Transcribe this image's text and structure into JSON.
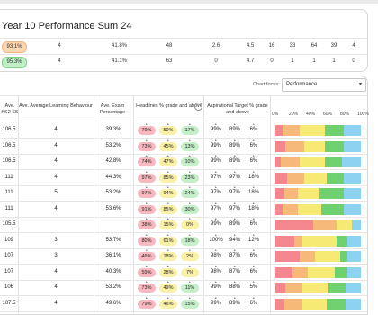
{
  "header": {
    "title": "Year  10  Performance  Sum  24"
  },
  "summary_rows": [
    {
      "badge": "93.1%",
      "badge_color": "orange",
      "values": [
        "4",
        "41.8%",
        "48",
        "2.6",
        "4.5",
        "16",
        "33",
        "64",
        "39",
        "4"
      ]
    },
    {
      "badge": "95.3%",
      "badge_color": "green",
      "values": [
        "4",
        "41.1%",
        "63",
        "0",
        "4.7",
        "0",
        "1",
        "1",
        "1",
        "0"
      ]
    }
  ],
  "chart_focus": {
    "label": "Chart focus:",
    "value": "Performance"
  },
  "columns": {
    "ks2": "Ave. KS2 SS",
    "alb": "Ave. Average Learning Behaviour",
    "exam": "Ave. Exam Percentage",
    "headlines": "Headlines % grade and above",
    "asp": "Aspirational Target % grade and above"
  },
  "pct_axis": [
    "0%",
    "20%",
    "40%",
    "60%",
    "80%",
    "100%"
  ],
  "colors": {
    "red": "#f4868e",
    "orange": "#f6b97a",
    "yellow": "#f7ea74",
    "green": "#6fd06f",
    "blue": "#8ed2f2"
  },
  "rows": [
    {
      "ks2": "106.5",
      "alb": "4",
      "exam": "39.3%",
      "h": [
        "79%",
        "50%",
        "17%"
      ],
      "a": [
        "99%",
        "89%",
        "6%"
      ],
      "dist": [
        8,
        20,
        30,
        22,
        20
      ]
    },
    {
      "ks2": "106.5",
      "alb": "4",
      "exam": "53.2%",
      "h": [
        "73%",
        "45%",
        "13%"
      ],
      "a": [
        "99%",
        "89%",
        "6%"
      ],
      "dist": [
        12,
        22,
        24,
        22,
        20
      ]
    },
    {
      "ks2": "106.5",
      "alb": "4",
      "exam": "42.8%",
      "h": [
        "74%",
        "47%",
        "10%"
      ],
      "a": [
        "99%",
        "89%",
        "6%"
      ],
      "dist": [
        6,
        22,
        30,
        20,
        22
      ]
    },
    {
      "ks2": "111",
      "alb": "4",
      "exam": "44.3%",
      "h": [
        "97%",
        "85%",
        "23%"
      ],
      "a": [
        "97%",
        "97%",
        "18%"
      ],
      "dist": [
        14,
        20,
        26,
        20,
        20
      ]
    },
    {
      "ks2": "111",
      "alb": "5",
      "exam": "53.2%",
      "h": [
        "97%",
        "94%",
        "24%"
      ],
      "a": [
        "97%",
        "97%",
        "18%"
      ],
      "dist": [
        10,
        16,
        26,
        28,
        20
      ]
    },
    {
      "ks2": "111",
      "alb": "4",
      "exam": "53.6%",
      "h": [
        "91%",
        "85%",
        "30%"
      ],
      "a": [
        "97%",
        "97%",
        "18%"
      ],
      "dist": [
        8,
        18,
        28,
        26,
        20
      ]
    },
    {
      "ks2": "105.5",
      "alb": "",
      "exam": "",
      "h": [
        "38%",
        "15%",
        "0%"
      ],
      "a": [
        "99%",
        "89%",
        "6%"
      ],
      "dist": [
        44,
        28,
        18,
        0,
        10
      ]
    },
    {
      "ks2": "109",
      "alb": "3",
      "exam": "53.7%",
      "h": [
        "80%",
        "61%",
        "18%"
      ],
      "a": [
        "100%",
        "94%",
        "12%"
      ],
      "dist": [
        22,
        10,
        40,
        12,
        16
      ]
    },
    {
      "ks2": "107",
      "alb": "3",
      "exam": "36.1%",
      "h": [
        "46%",
        "18%",
        "2%"
      ],
      "a": [
        "98%",
        "87%",
        "6%"
      ],
      "dist": [
        28,
        18,
        30,
        8,
        16
      ]
    },
    {
      "ks2": "107",
      "alb": "4",
      "exam": "40.3%",
      "h": [
        "59%",
        "28%",
        "7%"
      ],
      "a": [
        "98%",
        "87%",
        "6%"
      ],
      "dist": [
        20,
        18,
        32,
        14,
        16
      ]
    },
    {
      "ks2": "106",
      "alb": "4",
      "exam": "53.2%",
      "h": [
        "73%",
        "49%",
        "11%"
      ],
      "a": [
        "99%",
        "88%",
        "5%"
      ],
      "dist": [
        12,
        20,
        30,
        20,
        18
      ]
    },
    {
      "ks2": "107.5",
      "alb": "4",
      "exam": "49.6%",
      "h": [
        "79%",
        "46%",
        "15%"
      ],
      "a": [
        "99%",
        "89%",
        "6%"
      ],
      "dist": [
        10,
        22,
        28,
        22,
        18
      ]
    }
  ]
}
